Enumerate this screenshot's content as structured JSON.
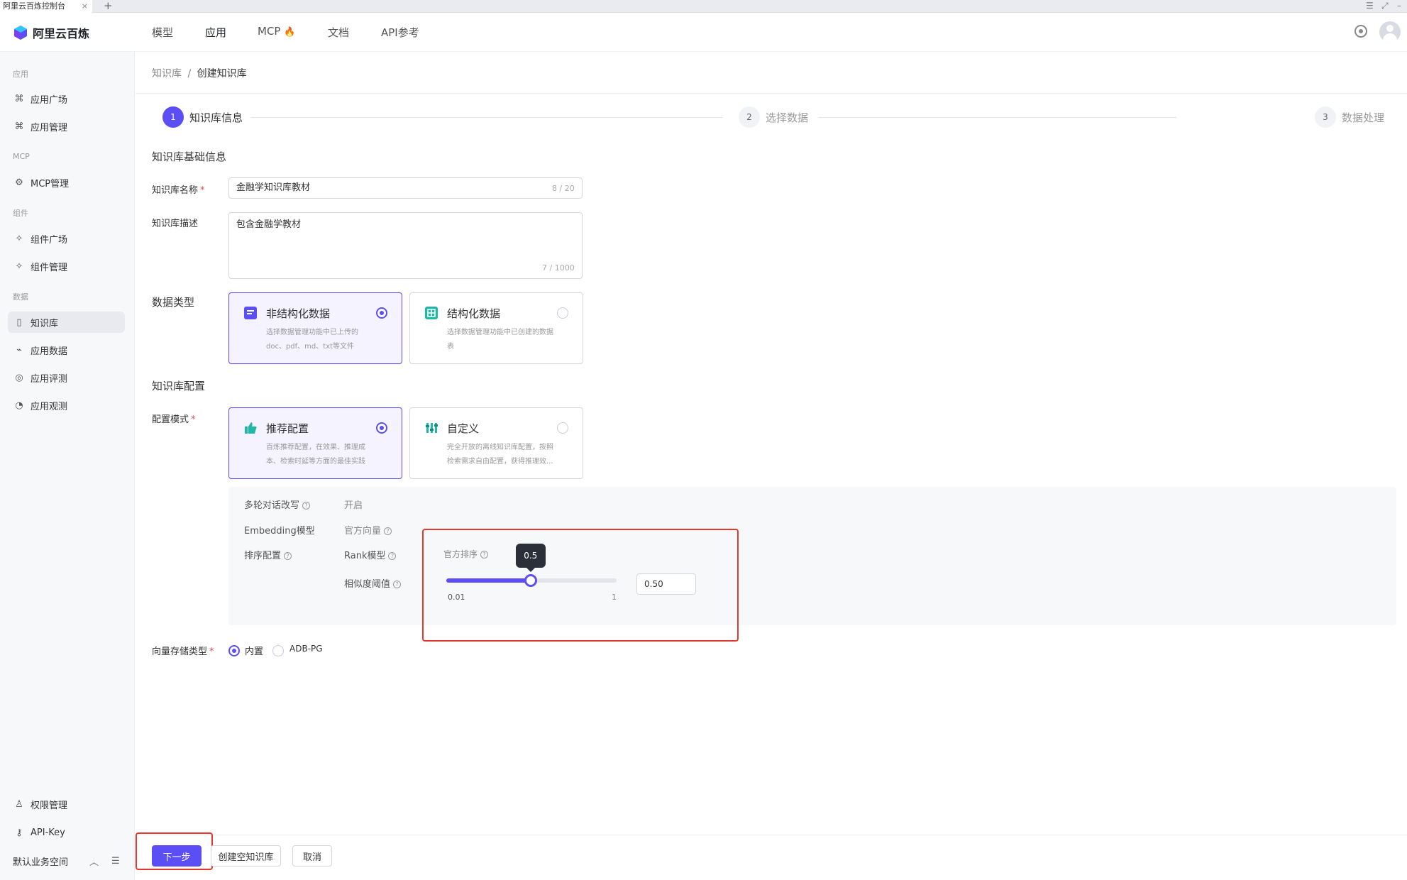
{
  "window": {
    "tab_title": "阿里云百炼控制台",
    "tab_close": "×",
    "new_tab": "+"
  },
  "topnav": {
    "logo_text": "阿里云百炼",
    "items": [
      "模型",
      "应用",
      "MCP",
      "文档",
      "API参考"
    ],
    "active": "应用",
    "mcp_badge_icon": "flame-icon"
  },
  "sidebar": {
    "groups": {
      "app": "应用",
      "mcp": "MCP",
      "component": "组件",
      "data": "数据"
    },
    "items": {
      "app_plaza": "应用广场",
      "app_manage": "应用管理",
      "mcp_manage": "MCP管理",
      "comp_plaza": "组件广场",
      "comp_manage": "组件管理",
      "knowledge": "知识库",
      "app_data": "应用数据",
      "app_eval": "应用评测",
      "app_observe": "应用观测",
      "permissions": "权限管理",
      "api_key": "API-Key",
      "workspace": "默认业务空间"
    },
    "active": "知识库"
  },
  "breadcrumb": {
    "root": "知识库",
    "sep": "/",
    "current": "创建知识库"
  },
  "steps": [
    {
      "num": "1",
      "label": "知识库信息",
      "active": true
    },
    {
      "num": "2",
      "label": "选择数据",
      "active": false
    },
    {
      "num": "3",
      "label": "数据处理",
      "active": false
    }
  ],
  "basic": {
    "section_title": "知识库基础信息",
    "name_label": "知识库名称",
    "name_value": "金融学知识库教材",
    "name_counter": "8 / 20",
    "desc_label": "知识库描述",
    "desc_value": "包含金融学教材",
    "desc_counter": "7 / 1000",
    "required_mark": "*"
  },
  "data_type": {
    "label": "数据类型",
    "options": [
      {
        "title": "非结构化数据",
        "desc": "选择数据管理功能中已上传的doc、pdf、md、txt等文件",
        "selected": true,
        "icon": "document-icon"
      },
      {
        "title": "结构化数据",
        "desc": "选择数据管理功能中已创建的数据表",
        "selected": false,
        "icon": "table-icon"
      }
    ]
  },
  "config": {
    "section_title": "知识库配置",
    "mode_label": "配置模式",
    "modes": [
      {
        "title": "推荐配置",
        "desc": "百炼推荐配置，在效果、推理成本、检索时延等方面的最佳实践",
        "selected": true,
        "icon": "thumbs-up-icon"
      },
      {
        "title": "自定义",
        "desc": "完全开放的离线知识库配置，按照检索需求自由配置，获得推理效...",
        "selected": false,
        "icon": "sliders-icon"
      }
    ],
    "details": {
      "multi_turn_label": "多轮对话改写",
      "multi_turn_value": "开启",
      "embedding_label": "Embedding模型",
      "embedding_value": "官方向量",
      "rerank_label": "排序配置",
      "rank_model_label": "Rank模型",
      "rank_model_value": "官方排序",
      "threshold_label": "相似度阈值",
      "slider_min": "0.01",
      "slider_max": "1",
      "slider_value": 0.5,
      "slider_tooltip": "0.5",
      "threshold_input": "0.50",
      "help_glyph": "?"
    }
  },
  "vector_store": {
    "label": "向量存储类型",
    "options": [
      {
        "label": "内置",
        "selected": true
      },
      {
        "label": "ADB-PG",
        "selected": false
      }
    ]
  },
  "footer": {
    "next": "下一步",
    "create_empty": "创建空知识库",
    "cancel": "取消"
  },
  "colors": {
    "primary": "#5b4ef5",
    "highlight_box": "#e6392e",
    "teal_icon": "#1fb8a6"
  }
}
